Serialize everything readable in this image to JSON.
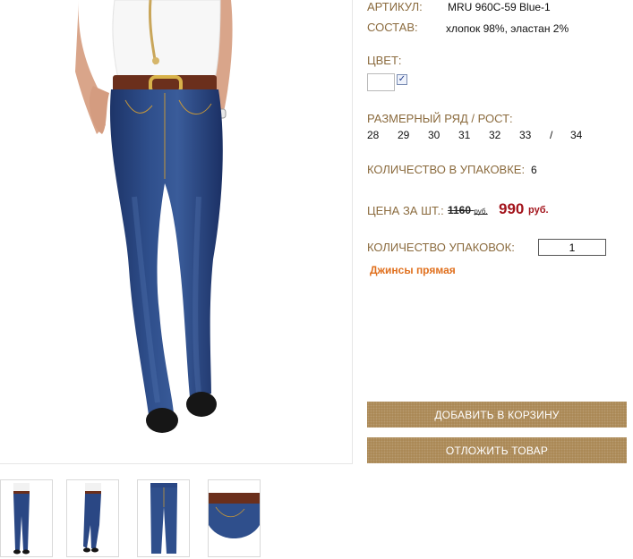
{
  "product": {
    "article_label": "АРТИКУЛ:",
    "article_value": "MRU 960C-59 Blue-1",
    "composition_label": "СОСТАВ:",
    "composition_value": "хлопок 98%, эластан 2%",
    "color_label": "ЦВЕТ:",
    "color_swatch": "#ffffff",
    "color_checked": "✓",
    "sizes_label": "РАЗМЕРНЫЙ РЯД / РОСТ:",
    "sizes": [
      "28",
      "29",
      "30",
      "31",
      "32",
      "33",
      "/",
      "34"
    ],
    "pack_label": "КОЛИЧЕСТВО В УПАКОВКЕ:",
    "pack_value": "6",
    "price_label": "ЦЕНА ЗА ШТ.:",
    "old_price": "1160",
    "old_currency": "руб.",
    "new_price": "990",
    "new_currency": "руб.",
    "qty_label": "КОЛИЧЕСТВО УПАКОВОК:",
    "qty_value": "1",
    "category_link": "Джинсы прямая"
  },
  "buttons": {
    "add_to_cart": "ДОБАВИТЬ В КОРЗИНУ",
    "postpone": "ОТЛОЖИТЬ ТОВАР"
  },
  "images": {
    "main": "jeans-model-front-photo",
    "thumbnails": [
      "jeans-front-thumb",
      "jeans-side-thumb",
      "jeans-flat-thumb",
      "jeans-detail-thumb"
    ]
  },
  "colors": {
    "label": "#8b6b3e",
    "price_red": "#a3141c",
    "link_orange": "#e0701e",
    "button_bg": "#a88551",
    "denim": "#253f78"
  }
}
